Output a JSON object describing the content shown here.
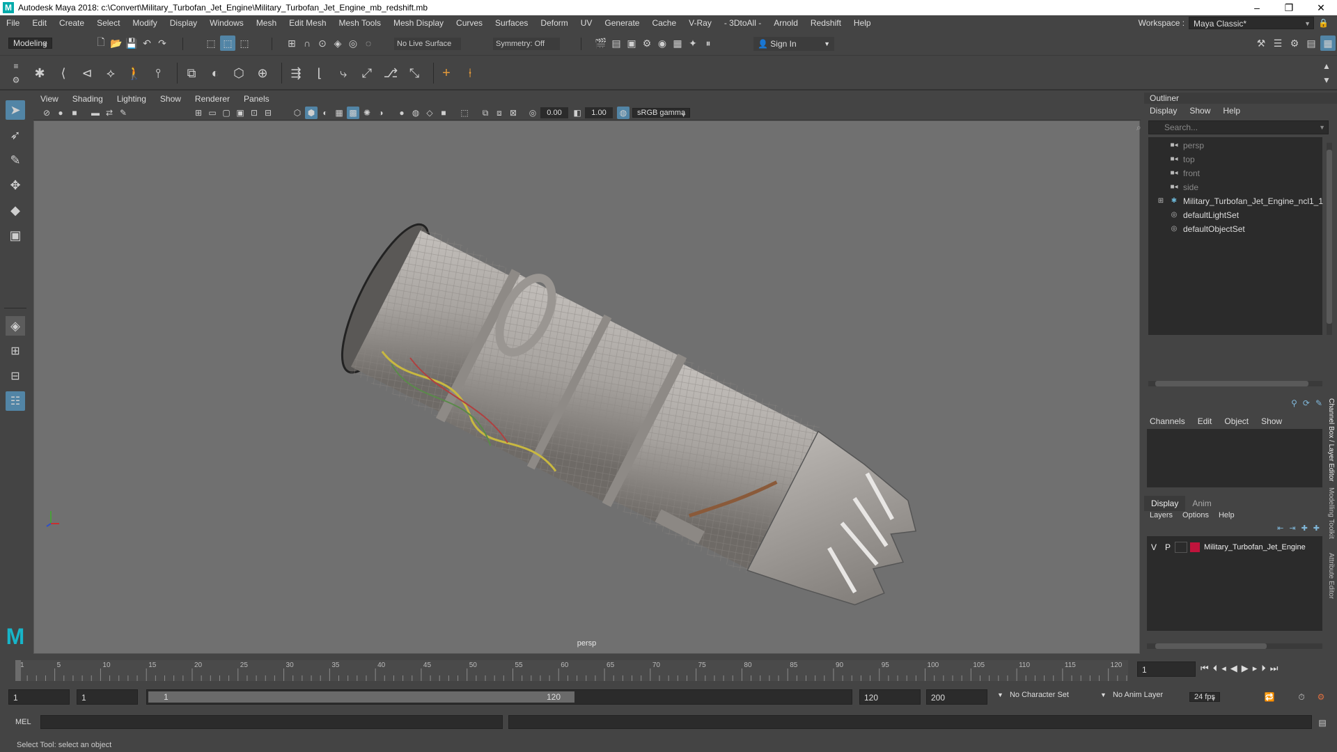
{
  "window": {
    "title": "Autodesk Maya 2018: c:\\Convert\\Military_Turbofan_Jet_Engine\\Military_Turbofan_Jet_Engine_mb_redshift.mb",
    "logo": "M",
    "minimize": "–",
    "maximize": "❐",
    "close": "✕"
  },
  "menubar": {
    "items": [
      "File",
      "Edit",
      "Create",
      "Select",
      "Modify",
      "Display",
      "Windows",
      "Mesh",
      "Edit Mesh",
      "Mesh Tools",
      "Mesh Display",
      "Curves",
      "Surfaces",
      "Deform",
      "UV",
      "Generate",
      "Cache",
      "V-Ray",
      "- 3DtoAll -",
      "Arnold",
      "Redshift",
      "Help"
    ],
    "workspace_label": "Workspace :",
    "workspace_value": "Maya Classic*"
  },
  "statusline": {
    "mode": "Modeling",
    "live_surface": "No Live Surface",
    "symmetry": "Symmetry: Off",
    "sign_in": "Sign In"
  },
  "viewport": {
    "menu": [
      "View",
      "Shading",
      "Lighting",
      "Show",
      "Renderer",
      "Panels"
    ],
    "exposure": "0.00",
    "gamma": "1.00",
    "color_space": "sRGB gamma",
    "camera": "persp"
  },
  "outliner": {
    "title": "Outliner",
    "menu": [
      "Display",
      "Show",
      "Help"
    ],
    "search_placeholder": "Search...",
    "items": [
      {
        "label": "persp",
        "type": "camera"
      },
      {
        "label": "top",
        "type": "camera"
      },
      {
        "label": "front",
        "type": "camera"
      },
      {
        "label": "side",
        "type": "camera"
      },
      {
        "label": "Military_Turbofan_Jet_Engine_ncl1_1",
        "type": "group"
      },
      {
        "label": "defaultLightSet",
        "type": "set"
      },
      {
        "label": "defaultObjectSet",
        "type": "set"
      }
    ]
  },
  "channelbox": {
    "menu": [
      "Channels",
      "Edit",
      "Object",
      "Show"
    ],
    "layer_tabs": [
      "Display",
      "Anim"
    ],
    "layer_menu": [
      "Layers",
      "Options",
      "Help"
    ],
    "layer": {
      "v": "V",
      "p": "P",
      "name": "Military_Turbofan_Jet_Engine",
      "color": "#c0143c"
    },
    "side_tabs": [
      "Channel Box / Layer Editor",
      "Modelling Toolkit",
      "Attribute Editor"
    ]
  },
  "timeline": {
    "ticks": [
      "1",
      "5",
      "10",
      "15",
      "20",
      "25",
      "30",
      "35",
      "40",
      "45",
      "50",
      "55",
      "60",
      "65",
      "70",
      "75",
      "80",
      "85",
      "90",
      "95",
      "100",
      "105",
      "110",
      "115",
      "120"
    ],
    "current_frame": "1"
  },
  "range": {
    "start": "1",
    "playback_start": "1",
    "slider_start": "1",
    "slider_end": "120",
    "playback_end": "120",
    "end": "200",
    "character_set": "No Character Set",
    "anim_layer": "No Anim Layer",
    "fps": "24 fps"
  },
  "commandline": {
    "label": "MEL"
  },
  "helpline": {
    "text": "Select Tool: select an object"
  },
  "colors": {
    "accent": "#5285a6",
    "viewport_bg": "#707070",
    "panel_bg": "#444444"
  }
}
